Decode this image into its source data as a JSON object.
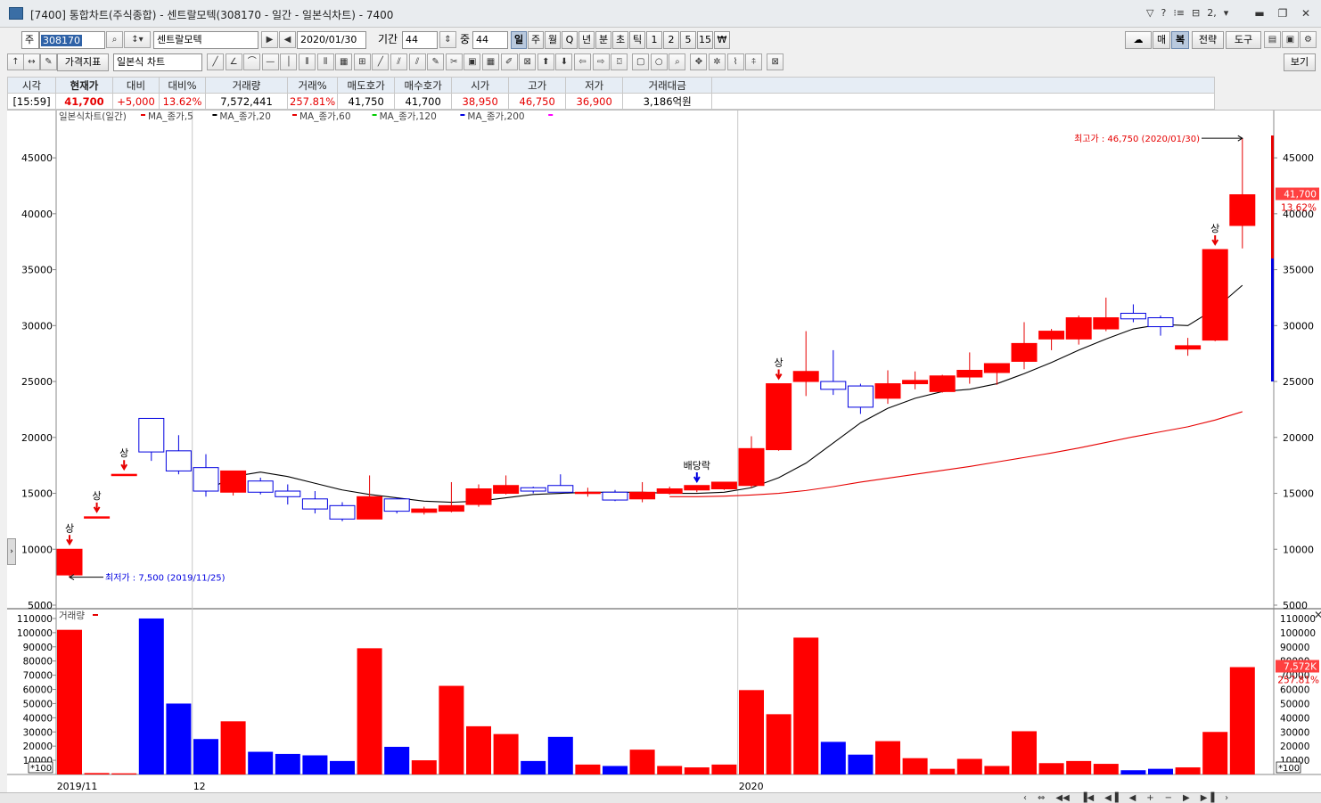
{
  "window": {
    "title": "[7400] 통합차트(주식종합) - 센트랄모텍(308170 - 일간 - 일본식차트) - 7400",
    "small_icons": [
      "▽",
      "?",
      "⁝≡",
      "⊟",
      "2,",
      "▾"
    ],
    "controls": [
      "▬",
      "❐",
      "✕"
    ]
  },
  "toolbar1": {
    "market_label": "주",
    "code": "308170",
    "name": "센트랄모텍",
    "date": "2020/01/30",
    "period_label": "기간",
    "period_value": "44",
    "overlap_label": "중",
    "overlap_value": "44",
    "intervals": [
      "일",
      "주",
      "월",
      "Q",
      "년",
      "분",
      "초",
      "틱",
      "1",
      "2",
      "5",
      "15",
      "₩"
    ],
    "selected_interval": "일",
    "right_buttons": [
      "매",
      "복",
      "전략",
      "도구"
    ]
  },
  "toolbar2": {
    "indicator_label": "가격지표",
    "chart_type": "일본식 차트",
    "view_label": "보기"
  },
  "quote": {
    "headers": [
      "시각",
      "현재가",
      "대비",
      "대비%",
      "거래량",
      "거래%",
      "매도호가",
      "매수호가",
      "시가",
      "고가",
      "저가",
      "거래대금"
    ],
    "values": [
      "[15:59]",
      "41,700",
      "+5,000",
      "13.62%",
      "7,572,441",
      "257.81%",
      "41,750",
      "41,700",
      "38,950",
      "46,750",
      "36,900",
      "3,186억원"
    ]
  },
  "chart_data": {
    "type": "candlestick",
    "title": "일본식차트(일간)",
    "legend": [
      {
        "name": "MA_종가,5",
        "color": "#e60000"
      },
      {
        "name": "MA_종가,20",
        "color": "#000000"
      },
      {
        "name": "MA_종가,60",
        "color": "#e60000"
      },
      {
        "name": "MA_종가,120",
        "color": "#00cc00"
      },
      {
        "name": "MA_종가,200",
        "color": "#0000e0"
      }
    ],
    "ylim": [
      5000,
      47000
    ],
    "yticks": [
      45000,
      40000,
      35000,
      30000,
      25000,
      20000,
      15000,
      10000,
      5000
    ],
    "x_labels": [
      {
        "index": 0,
        "label": "2019/11"
      },
      {
        "index": 5,
        "label": "12"
      },
      {
        "index": 25,
        "label": "2020"
      }
    ],
    "candles": [
      {
        "o": 7700,
        "h": 10000,
        "l": 7500,
        "c": 10000
      },
      {
        "o": 12900,
        "h": 12900,
        "l": 12900,
        "c": 12900
      },
      {
        "o": 16700,
        "h": 16700,
        "l": 16700,
        "c": 16700
      },
      {
        "o": 21700,
        "h": 21700,
        "l": 17900,
        "c": 18700
      },
      {
        "o": 18800,
        "h": 20200,
        "l": 16700,
        "c": 17000
      },
      {
        "o": 17300,
        "h": 18500,
        "l": 14700,
        "c": 15200
      },
      {
        "o": 15100,
        "h": 17000,
        "l": 14800,
        "c": 17000
      },
      {
        "o": 16100,
        "h": 16400,
        "l": 14900,
        "c": 15100
      },
      {
        "o": 15200,
        "h": 15800,
        "l": 14000,
        "c": 14700
      },
      {
        "o": 14500,
        "h": 15200,
        "l": 13200,
        "c": 13600
      },
      {
        "o": 13900,
        "h": 14200,
        "l": 12500,
        "c": 12700
      },
      {
        "o": 12700,
        "h": 16600,
        "l": 12700,
        "c": 14700
      },
      {
        "o": 14500,
        "h": 14600,
        "l": 13200,
        "c": 13400
      },
      {
        "o": 13300,
        "h": 13800,
        "l": 13100,
        "c": 13600
      },
      {
        "o": 13400,
        "h": 16000,
        "l": 13300,
        "c": 13900
      },
      {
        "o": 14000,
        "h": 15800,
        "l": 13800,
        "c": 15400
      },
      {
        "o": 15000,
        "h": 16600,
        "l": 14900,
        "c": 15700
      },
      {
        "o": 15500,
        "h": 15600,
        "l": 15000,
        "c": 15200
      },
      {
        "o": 15700,
        "h": 16700,
        "l": 15200,
        "c": 15100
      },
      {
        "o": 15000,
        "h": 15500,
        "l": 14700,
        "c": 15100
      },
      {
        "o": 15100,
        "h": 15300,
        "l": 14300,
        "c": 14400
      },
      {
        "o": 14500,
        "h": 16000,
        "l": 14200,
        "c": 15100
      },
      {
        "o": 15000,
        "h": 15600,
        "l": 14900,
        "c": 15400
      },
      {
        "o": 15300,
        "h": 15600,
        "l": 15100,
        "c": 15700
      },
      {
        "o": 15400,
        "h": 16000,
        "l": 15300,
        "c": 16000
      },
      {
        "o": 15700,
        "h": 20100,
        "l": 15500,
        "c": 19000
      },
      {
        "o": 18900,
        "h": 24800,
        "l": 18800,
        "c": 24800
      },
      {
        "o": 25000,
        "h": 29500,
        "l": 23700,
        "c": 25900
      },
      {
        "o": 25000,
        "h": 27800,
        "l": 23800,
        "c": 24300
      },
      {
        "o": 24600,
        "h": 24800,
        "l": 22100,
        "c": 22700
      },
      {
        "o": 23500,
        "h": 26000,
        "l": 23000,
        "c": 24800
      },
      {
        "o": 24800,
        "h": 25900,
        "l": 24300,
        "c": 25100
      },
      {
        "o": 24100,
        "h": 25600,
        "l": 24000,
        "c": 25500
      },
      {
        "o": 25400,
        "h": 27600,
        "l": 24800,
        "c": 26000
      },
      {
        "o": 25800,
        "h": 26600,
        "l": 24700,
        "c": 26600
      },
      {
        "o": 26800,
        "h": 30300,
        "l": 26100,
        "c": 28400
      },
      {
        "o": 28800,
        "h": 29700,
        "l": 27800,
        "c": 29500
      },
      {
        "o": 28800,
        "h": 30900,
        "l": 28300,
        "c": 30700
      },
      {
        "o": 29700,
        "h": 32500,
        "l": 29500,
        "c": 30700
      },
      {
        "o": 31100,
        "h": 31900,
        "l": 30300,
        "c": 30600
      },
      {
        "o": 30700,
        "h": 30900,
        "l": 29100,
        "c": 29900
      },
      {
        "o": 27900,
        "h": 28900,
        "l": 27300,
        "c": 28200
      },
      {
        "o": 28700,
        "h": 36800,
        "l": 28600,
        "c": 36800
      },
      {
        "o": 38950,
        "h": 46750,
        "l": 36900,
        "c": 41700
      }
    ],
    "ma20": [
      null,
      null,
      null,
      null,
      null,
      15200,
      16500,
      16900,
      16500,
      15900,
      15300,
      14900,
      14600,
      14300,
      14200,
      14300,
      14600,
      14900,
      15000,
      15100,
      15100,
      15100,
      15000,
      15000,
      15100,
      15500,
      16400,
      17700,
      19500,
      21300,
      22600,
      23500,
      24100,
      24300,
      24800,
      25700,
      26700,
      27800,
      28800,
      29700,
      30100,
      30000,
      31500,
      33600
    ],
    "ma60": [
      null,
      null,
      null,
      null,
      null,
      null,
      null,
      null,
      null,
      null,
      null,
      null,
      null,
      null,
      null,
      null,
      null,
      null,
      null,
      null,
      null,
      null,
      14700,
      14700,
      14750,
      14850,
      15000,
      15250,
      15600,
      16000,
      16350,
      16700,
      17050,
      17400,
      17800,
      18200,
      18600,
      19050,
      19550,
      20050,
      20500,
      20950,
      21550,
      22300
    ],
    "annotations": [
      {
        "index": 0,
        "label": "상"
      },
      {
        "index": 1,
        "label": "상"
      },
      {
        "index": 2,
        "label": "상"
      },
      {
        "index": 23,
        "label": "배당락"
      },
      {
        "index": 26,
        "label": "상"
      },
      {
        "index": 42,
        "label": "상"
      }
    ],
    "high_label": "최고가 : 46,750 (2020/01/30)",
    "low_label": "최저가 : 7,500 (2019/11/25)",
    "current_price": "41,700",
    "current_pct": "13.62%",
    "volume": {
      "title": "거래량",
      "ylim": [
        0,
        115000
      ],
      "yticks": [
        110000,
        100000,
        90000,
        80000,
        70000,
        60000,
        50000,
        40000,
        30000,
        20000,
        10000
      ],
      "unit": "*100",
      "current_label": "7,572K",
      "current_pct": "257.81%",
      "values": [
        102000,
        1000,
        800,
        110000,
        50000,
        25000,
        37500,
        16000,
        14500,
        13500,
        9500,
        89000,
        19500,
        10000,
        62500,
        34000,
        28500,
        9500,
        26500,
        7000,
        6000,
        17500,
        6000,
        5000,
        7000,
        59500,
        42500,
        96500,
        23000,
        14000,
        23500,
        11500,
        4000,
        11000,
        6000,
        30500,
        8000,
        9500,
        7500,
        3000,
        4000,
        5000,
        30000,
        75700
      ]
    }
  }
}
